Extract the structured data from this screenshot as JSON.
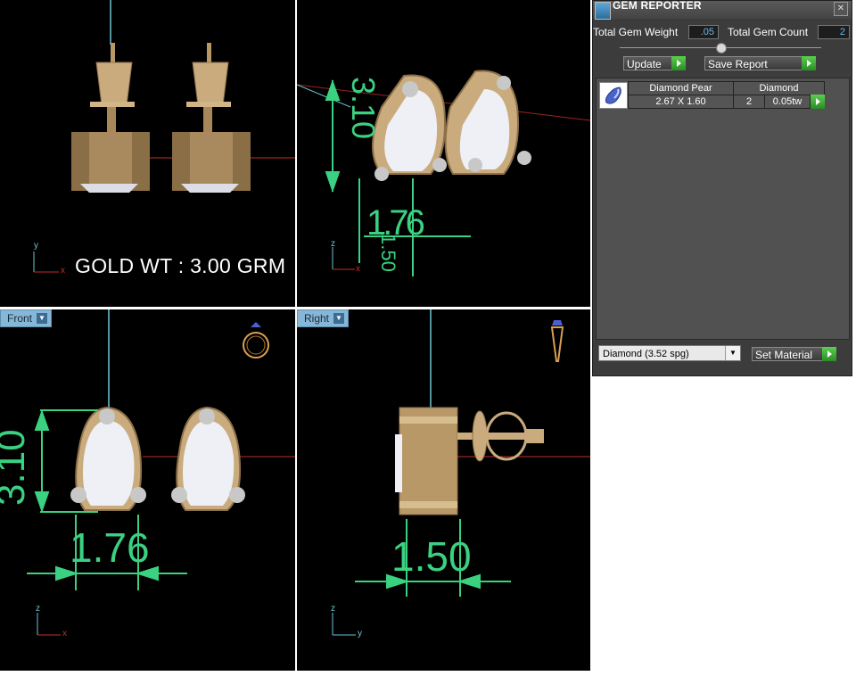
{
  "viewports": {
    "top_left": {
      "label": "GOLD WT : 3.00 GRM",
      "axis_y": "y",
      "axis_x": "x"
    },
    "perspective": {
      "axis_z": "z",
      "axis_x": "x",
      "dim_height": "3.10",
      "dim_width_a": "1.76",
      "dim_width_b": "1.50"
    },
    "front": {
      "name": "Front",
      "dim_height": "3.10",
      "dim_width": "1.76",
      "axis_z": "z",
      "axis_x": "x",
      "icon": "ring-icon"
    },
    "right": {
      "name": "Right",
      "dim_width": "1.50",
      "axis_z": "z",
      "axis_y": "y",
      "icon": "pendant-icon"
    }
  },
  "gem_reporter": {
    "title": "GEM REPORTER",
    "total_gem_weight_label": "Total Gem Weight",
    "total_gem_weight_value": ".05",
    "total_gem_count_label": "Total Gem Count",
    "total_gem_count_value": "2",
    "update_label": "Update",
    "save_report_label": "Save Report",
    "table": {
      "headers": [
        "Diamond Pear",
        "Diamond"
      ],
      "row": {
        "size": "2.67 X 1.60",
        "count": "2",
        "weight": "0.05tw"
      }
    },
    "material_select": "Diamond    (3.52 spg)",
    "set_material_label": "Set Material"
  },
  "colors": {
    "viewport_bg": "#000000",
    "dimension_green": "#3ad181",
    "gold": "#c9ab7e",
    "axis_red": "#c0302a",
    "axis_cyan": "#6ec5d6",
    "panel_bg": "#3c3c3c",
    "value_blue": "#6fb7e8"
  }
}
